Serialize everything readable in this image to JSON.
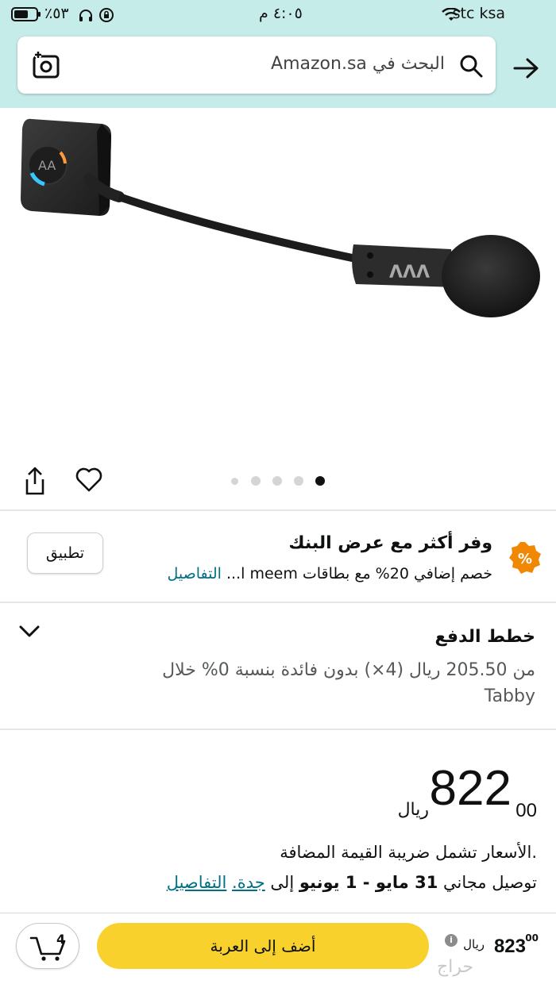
{
  "status": {
    "carrier": "stc ksa",
    "time": "٤:٠٥ م",
    "battery": "٪٥٣"
  },
  "search": {
    "placeholder": "البحث في Amazon.sa"
  },
  "gallery": {
    "dot_count": 5,
    "active_index": 4
  },
  "bank_offer": {
    "title": "وفر أكثر مع عرض البنك",
    "subtitle": "خصم إضافي 20% مع بطاقات meem ا...",
    "details_link": "التفاصيل",
    "apply_label": "تطبيق",
    "badge_symbol": "%"
  },
  "payment_plans": {
    "title": "خطط الدفع",
    "text": "من 205.50 ريال (4×) بدون فائدة بنسبة 0% خلال Tabby"
  },
  "price": {
    "currency": "ريال",
    "whole": "822",
    "fraction": "00",
    "vat_note": ".الأسعار تشمل ضريبة القيمة المضافة"
  },
  "delivery": {
    "prefix": "توصيل مجاني",
    "dates": "31 مايو - 1 يونيو",
    "to": "إلى",
    "city": "جدة.",
    "details_link": "التفاصيل"
  },
  "bottom_bar": {
    "cart_count": "4",
    "add_to_cart": "أضف إلى العربة",
    "price_whole": "823",
    "price_fraction": "00",
    "currency": "ريال",
    "info": "i"
  },
  "watermark": "حراج",
  "colors": {
    "header_bg": "#c6ecea",
    "add_button": "#f8d12d",
    "badge": "#f08804",
    "link": "#007185"
  }
}
